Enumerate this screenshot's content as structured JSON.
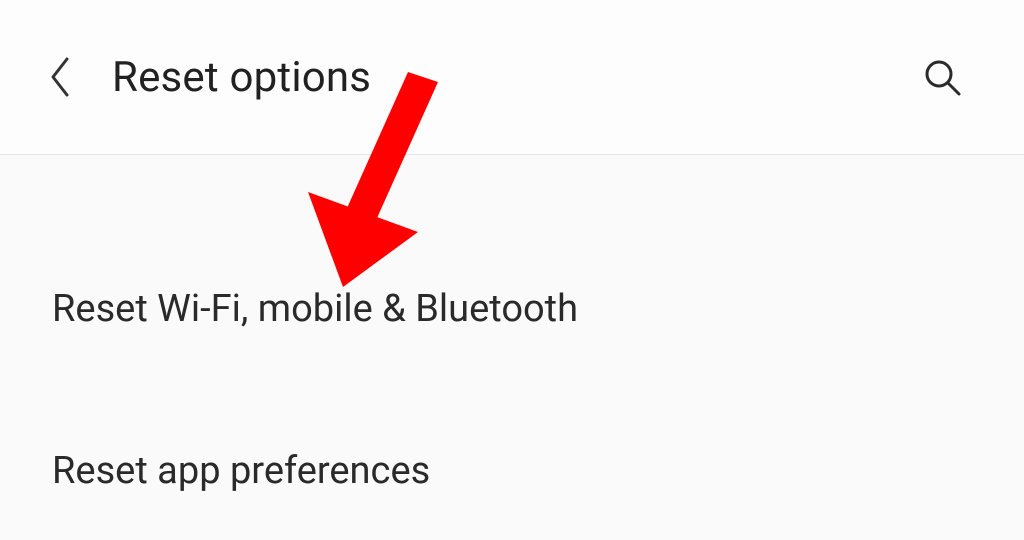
{
  "header": {
    "title": "Reset options"
  },
  "options": {
    "items": [
      "Reset Wi-Fi, mobile & Bluetooth",
      "Reset app preferences"
    ]
  },
  "annotation": {
    "arrow_color": "#ff0000"
  }
}
